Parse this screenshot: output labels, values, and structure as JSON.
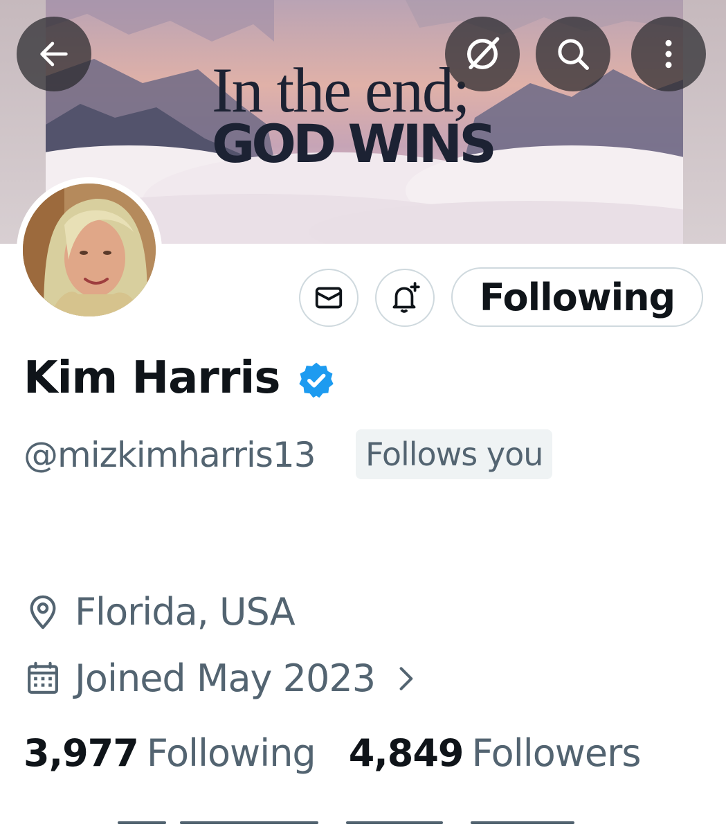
{
  "banner": {
    "line1": "In the end;",
    "line2": "GOD WINS"
  },
  "header": {
    "back": "arrow-left-icon",
    "grok": "grok-icon",
    "search": "search-icon",
    "more": "more-vertical-icon"
  },
  "actions": {
    "message": "mail-icon",
    "notify": "bell-plus-icon",
    "follow_label": "Following"
  },
  "profile": {
    "name": "Kim Harris",
    "verified": true,
    "handle": "@mizkimharris13",
    "follows_you": "Follows you",
    "location": "Florida, USA",
    "joined": "Joined May 2023",
    "following_count": "3,977",
    "following_label": "Following",
    "followers_count": "4,849",
    "followers_label": "Followers"
  },
  "colors": {
    "text_primary": "#0f1419",
    "text_secondary": "#536471",
    "border": "#cfd9de",
    "verified_blue": "#1d9bf0",
    "pill_bg": "#eff3f4"
  }
}
